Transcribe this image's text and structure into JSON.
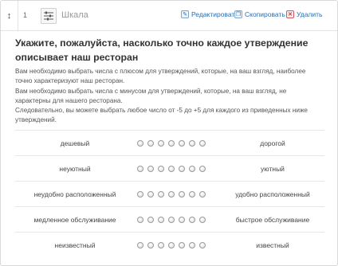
{
  "header": {
    "drag_glyph": "↕",
    "number": "1",
    "type_icon": "sliders-icon",
    "type_label": "Шкала",
    "actions": {
      "edit": "Редактировать",
      "copy": "Скопировать",
      "delete": "Удалить"
    },
    "action_icons": [
      "pencil-icon",
      "copy-icon",
      "close-icon"
    ]
  },
  "question": {
    "title": "Укажите, пожалуйста, насколько точно каждое утверждение описывает наш ресторан",
    "description": [
      "Вам необходимо выбрать числа с плюсом для утверждений, которые, на ваш взгляд, наиболее",
      "точно характеризуют наш ресторан.",
      "Вам необходимо выбрать числа с минусом для утверждений, которые, на ваш взгляд, не",
      "характерны для нашего ресторана.",
      "Следовательно, вы можете выбрать любое число от -5 до +5 для каждого из приведенных ниже",
      "утверждений."
    ]
  },
  "scale_rows": [
    {
      "left": "дешевый",
      "right": "дорогой"
    },
    {
      "left": "неуютный",
      "right": "уютный"
    },
    {
      "left": "неудобно расположенный",
      "right": "удобно расположенный"
    },
    {
      "left": "медленное обслуживание",
      "right": "быстрое обслуживание"
    },
    {
      "left": "неизвестный",
      "right": "известный"
    }
  ],
  "radio_count": 7
}
